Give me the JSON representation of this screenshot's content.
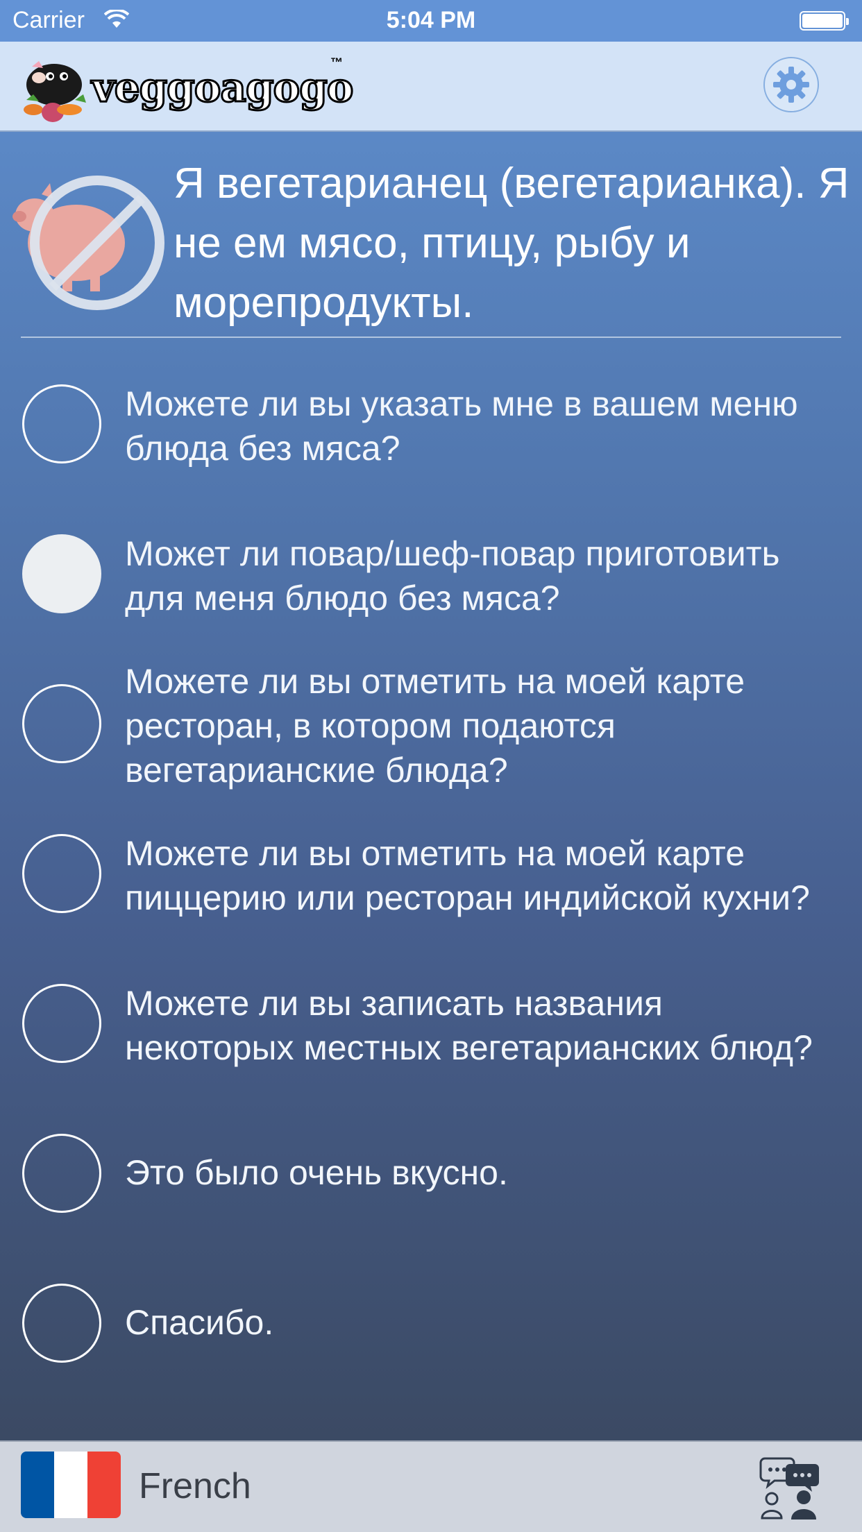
{
  "status_bar": {
    "carrier": "Carrier",
    "time": "5:04 PM"
  },
  "header": {
    "logo_text": "veggoagogo",
    "logo_tm": "™",
    "settings_icon": "gear-icon"
  },
  "statement": {
    "icon": "no-meat-pig-icon",
    "text": "Я вегетарианец (вегетарианка). Я не ем мясо, птицу, рыбу и морепродукты."
  },
  "phrases": [
    {
      "text": "Можете ли вы указать мне в вашем меню блюда без мяса?",
      "selected": false
    },
    {
      "text": "Может ли повар/шеф-повар приготовить для меня блюдо без мяса?",
      "selected": true
    },
    {
      "text": "Можете ли вы отметить на моей карте ресторан, в котором подаются вегетарианские блюда?",
      "selected": false
    },
    {
      "text": "Можете ли вы отметить на моей карте пиццерию или ресторан индийской кухни?",
      "selected": false
    },
    {
      "text": "Можете ли вы записать названия некоторых местных вегетарианских блюд?",
      "selected": false
    },
    {
      "text": "Это было очень вкусно.",
      "selected": false
    },
    {
      "text": "Спасибо.",
      "selected": false
    }
  ],
  "bottom_bar": {
    "language": "French",
    "flag_colors": [
      "#0055a4",
      "#ffffff",
      "#ef4135"
    ],
    "chat_icon": "conversation-icon"
  },
  "colors": {
    "status_bar": "#6393d6",
    "header_bg": "#d3e3f7",
    "gradient_top": "#5f8fcf",
    "gradient_bottom": "#39465c",
    "bottom_bar": "#d0d5de"
  }
}
